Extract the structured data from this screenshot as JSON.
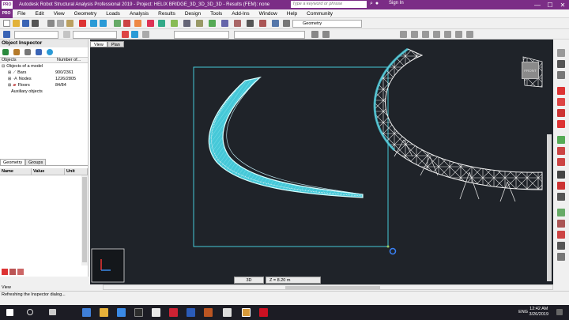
{
  "titlebar": {
    "app_badge": "PRO",
    "title": "Autodesk Robot Structural Analysis Professional 2019 - Project: HELIX BRIDGE_3D_3D_3D_3D - Results (FEM): none",
    "search_placeholder": "Type a keyword or phrase",
    "signin_label": "Sign In",
    "controls": [
      "—",
      "☐",
      "✕"
    ]
  },
  "menu": {
    "logo": "PRO",
    "items": [
      "File",
      "Edit",
      "View",
      "Geometry",
      "Loads",
      "Analysis",
      "Results",
      "Design",
      "Tools",
      "Add-Ins",
      "Window",
      "Help",
      "Community"
    ]
  },
  "toolbar": {
    "structure_view_value": "Geometry"
  },
  "inspector": {
    "title": "Object Inspector",
    "columns": [
      "Objects",
      "Number of..."
    ],
    "tree": [
      {
        "name": "Objects of a model",
        "count": ""
      },
      {
        "name": "Bars",
        "count": "900/2361"
      },
      {
        "name": "Nodes",
        "count": "1226/2805"
      },
      {
        "name": "Floors",
        "count": "84/84"
      },
      {
        "name": "Auxiliary objects",
        "count": ""
      }
    ],
    "tabs": [
      "Geometry",
      "Groups"
    ],
    "property_columns": [
      "Name",
      "Value",
      "Unit"
    ]
  },
  "viewport": {
    "tabs": [
      "View",
      "Plan"
    ],
    "viewcube_label": "FRONT",
    "mode_label": "3D",
    "z_label": "Z = 8.20 m",
    "background": "#1f2329",
    "selection_color": "#46c8d8",
    "mesh_color": "#e8e8e8"
  },
  "status": {
    "bottom_tab": "View",
    "message": "Refreshing the Inspector dialog..."
  },
  "taskbar": {
    "language": "ENG",
    "time": "12:42 AM",
    "date": "3/26/2019"
  }
}
